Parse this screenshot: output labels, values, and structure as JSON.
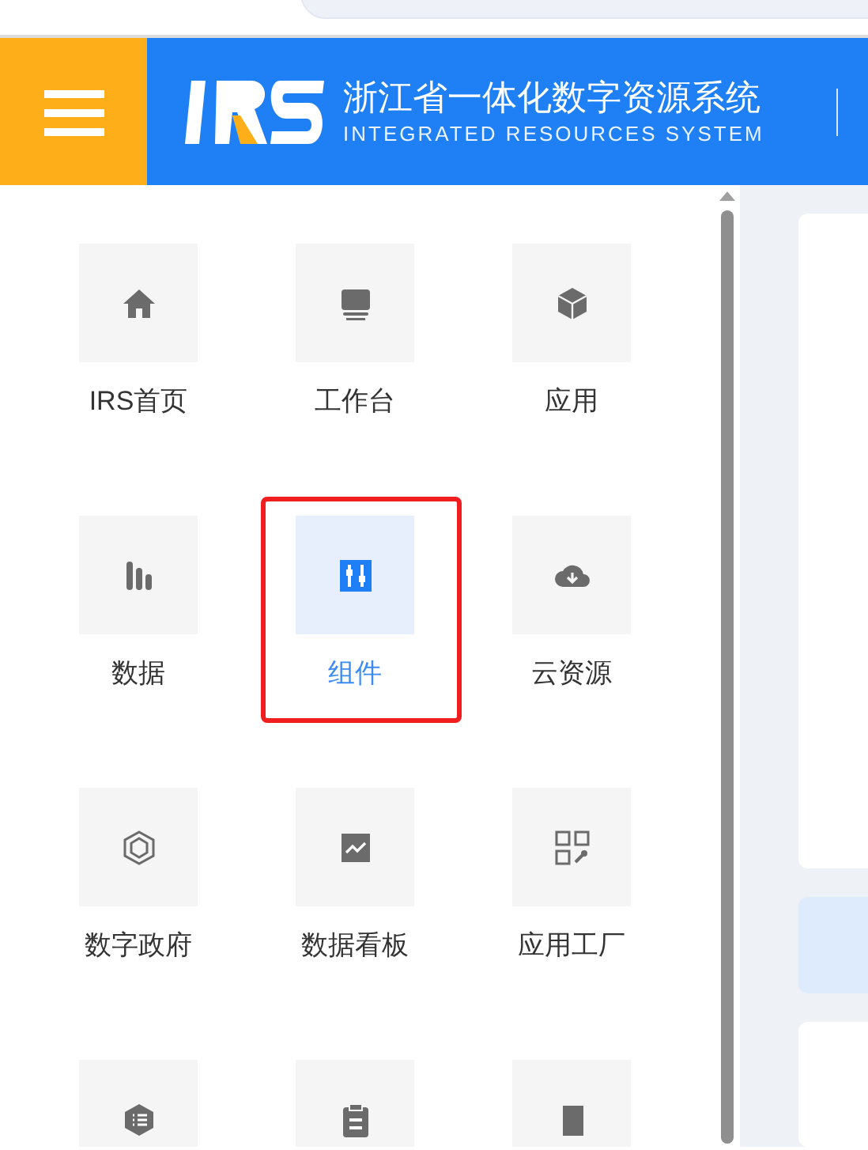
{
  "header": {
    "title": "浙江省一体化数字资源系统",
    "subtitle": "INTEGRATED RESOURCES SYSTEM"
  },
  "menu_items": [
    {
      "label": "IRS首页",
      "selected": false,
      "highlighted": false
    },
    {
      "label": "工作台",
      "selected": false,
      "highlighted": false
    },
    {
      "label": "应用",
      "selected": false,
      "highlighted": false
    },
    {
      "label": "数据",
      "selected": false,
      "highlighted": false
    },
    {
      "label": "组件",
      "selected": true,
      "highlighted": true
    },
    {
      "label": "云资源",
      "selected": false,
      "highlighted": false
    },
    {
      "label": "数字政府",
      "selected": false,
      "highlighted": false
    },
    {
      "label": "数据看板",
      "selected": false,
      "highlighted": false
    },
    {
      "label": "应用工厂",
      "selected": false,
      "highlighted": false
    },
    {
      "selected": false,
      "highlighted": false
    },
    {
      "selected": false,
      "highlighted": false
    },
    {
      "selected": false,
      "highlighted": false
    }
  ]
}
